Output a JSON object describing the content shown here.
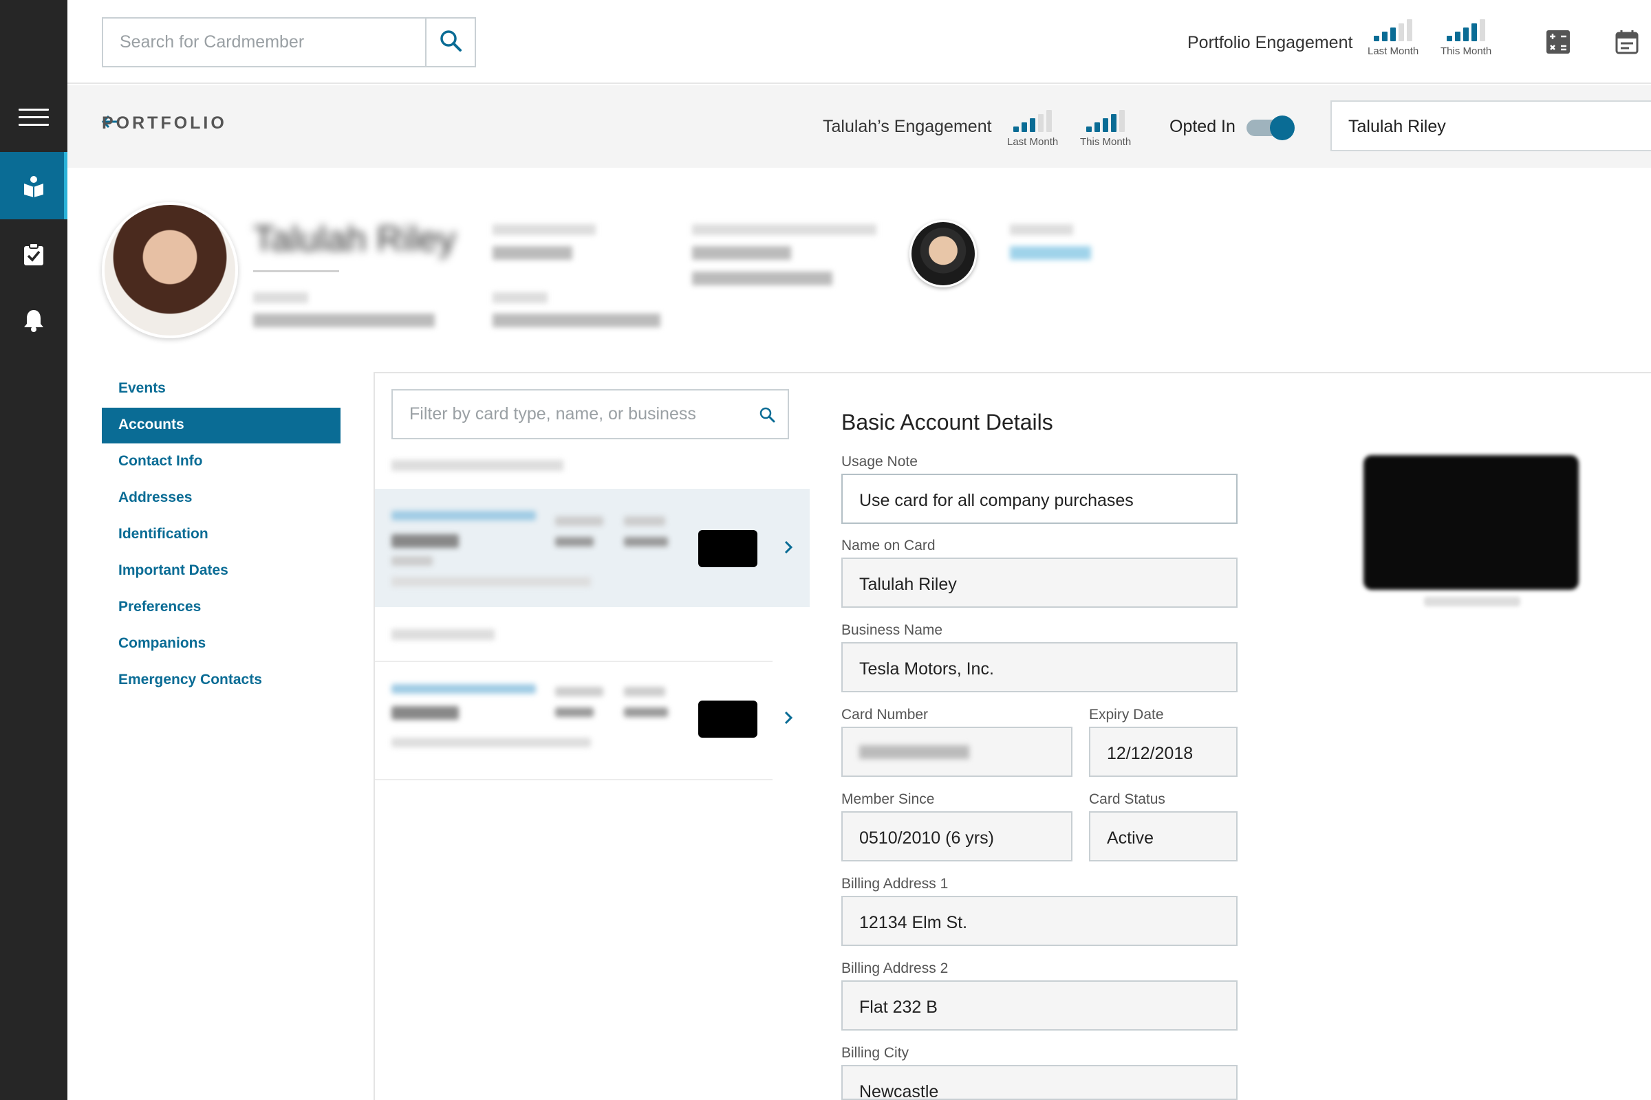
{
  "topbar": {
    "search_placeholder": "Search for Cardmember",
    "portfolio_engagement_label": "Portfolio Engagement",
    "last_month_label": "Last Month",
    "this_month_label": "This Month"
  },
  "subbar": {
    "back_label": "PORTFOLIO",
    "engagement_label": "Talulah’s Engagement",
    "last_month_label": "Last Month",
    "this_month_label": "This Month",
    "opted_in_label": "Opted In",
    "opted_in": true,
    "name_value": "Talulah Riley"
  },
  "profile": {
    "name": "Talulah Riley"
  },
  "sidenav": {
    "items": [
      {
        "label": "Events"
      },
      {
        "label": "Accounts"
      },
      {
        "label": "Contact Info"
      },
      {
        "label": "Addresses"
      },
      {
        "label": "Identification"
      },
      {
        "label": "Important Dates"
      },
      {
        "label": "Preferences"
      },
      {
        "label": "Companions"
      },
      {
        "label": "Emergency Contacts"
      }
    ],
    "active": "Accounts"
  },
  "cardlist": {
    "filter_placeholder": "Filter by card type, name, or business"
  },
  "details": {
    "title": "Basic Account Details",
    "usage_note_label": "Usage Note",
    "usage_note_value": "Use card for all company purchases",
    "name_on_card_label": "Name on Card",
    "name_on_card_value": "Talulah Riley",
    "business_name_label": "Business Name",
    "business_name_value": "Tesla Motors, Inc.",
    "card_number_label": "Card Number",
    "expiry_label": "Expiry Date",
    "expiry_value": "12/12/2018",
    "member_since_label": "Member Since",
    "member_since_value": "0510/2010 (6 yrs)",
    "card_status_label": "Card Status",
    "card_status_value": "Active",
    "billing1_label": "Billing Address 1",
    "billing1_value": "12134 Elm St.",
    "billing2_label": "Billing Address 2",
    "billing2_value": "Flat 232 B",
    "billing_city_label": "Billing City",
    "billing_city_value": "Newcastle"
  },
  "colors": {
    "primary": "#0a6c95",
    "rail": "#262626",
    "accent": "#2ab2d8"
  },
  "icons": {
    "rail": [
      "menu-icon",
      "book-person-icon",
      "clipboard-check-icon",
      "bell-icon"
    ],
    "top": [
      "search-icon",
      "calculator-icon",
      "calendar-icon"
    ]
  }
}
